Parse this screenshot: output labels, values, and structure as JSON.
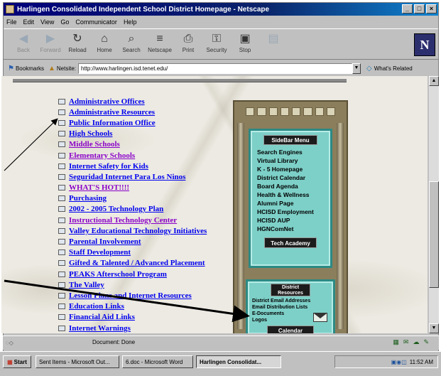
{
  "window": {
    "title": "Harlingen Consolidated Independent School District Homepage - Netscape",
    "controls": [
      "_",
      "□",
      "×"
    ]
  },
  "menu": [
    "File",
    "Edit",
    "View",
    "Go",
    "Communicator",
    "Help"
  ],
  "toolbar": {
    "buttons": [
      {
        "label": "Back",
        "icon": "back-arrow-icon",
        "glyph": "◀",
        "disabled": true
      },
      {
        "label": "Forward",
        "icon": "forward-arrow-icon",
        "glyph": "▶",
        "disabled": true
      },
      {
        "label": "Reload",
        "icon": "reload-icon",
        "glyph": "↻",
        "disabled": false
      },
      {
        "label": "Home",
        "icon": "home-icon",
        "glyph": "⌂",
        "disabled": false
      },
      {
        "label": "Search",
        "icon": "search-icon",
        "glyph": "⌕",
        "disabled": false
      },
      {
        "label": "Netscape",
        "icon": "netscape-icon",
        "glyph": "≡",
        "disabled": false
      },
      {
        "label": "Print",
        "icon": "print-icon",
        "glyph": "⎙",
        "disabled": false
      },
      {
        "label": "Security",
        "icon": "lock-icon",
        "glyph": "⚿",
        "disabled": false
      },
      {
        "label": "Stop",
        "icon": "stop-icon",
        "glyph": "▣",
        "disabled": false
      },
      {
        "label": "",
        "icon": "shop-icon",
        "glyph": "▤",
        "disabled": true
      }
    ],
    "logo": "N"
  },
  "location": {
    "bookmarks": "Bookmarks",
    "netsite": "Netsite:",
    "url": "http://www.harlingen.isd.tenet.edu/",
    "related": "What's Related"
  },
  "links": [
    {
      "text": "Administrative Offices",
      "visited": false
    },
    {
      "text": "Administrative Resources",
      "visited": false
    },
    {
      "text": "Public Information Office",
      "visited": false
    },
    {
      "text": "High Schools",
      "visited": false
    },
    {
      "text": "Middle Schools",
      "visited": true
    },
    {
      "text": "Elementary Schools",
      "visited": true
    },
    {
      "text": "Internet Safety for Kids",
      "visited": false
    },
    {
      "text": "Seguridad Internet Para Los Ninos",
      "visited": false
    },
    {
      "text": "WHAT'S HOT!!!!",
      "visited": true
    },
    {
      "text": "Purchasing",
      "visited": false
    },
    {
      "text": "2002 - 2005 Technology Plan",
      "visited": false
    },
    {
      "text": "Instructional Technology Center",
      "visited": true
    },
    {
      "text": "Valley Educational Technology Initiatives",
      "visited": false
    },
    {
      "text": "Parental Involvement",
      "visited": false
    },
    {
      "text": "Staff Development",
      "visited": false
    },
    {
      "text": "Gifted & Talented / Advanced Placement",
      "visited": false
    },
    {
      "text": "PEAKS Afterschool Program",
      "visited": false
    },
    {
      "text": "The Valley",
      "visited": false
    },
    {
      "text": "Lesson Plans and Internet Resources",
      "visited": false
    },
    {
      "text": "Education Links",
      "visited": false
    },
    {
      "text": "Financial Aid Links",
      "visited": false
    },
    {
      "text": "Internet Warnings",
      "visited": false
    }
  ],
  "sidebar": {
    "title": "SideBar Menu",
    "items": [
      "Search Engines",
      "Virtual Library",
      "K - 5 Homepage",
      "District Calendar",
      "Board Agenda",
      "Health & Wellness",
      "Alumni Page",
      "HCISD Employment",
      "HCISD AUP",
      "HGNComNet"
    ],
    "tech": "Tech Academy",
    "resources_title_1": "District",
    "resources_title_2": "Resources",
    "resources": [
      "District Email Addresses",
      "Email Distribution Lists",
      "E-Documents",
      "Logos"
    ],
    "calendar": "Calendar"
  },
  "status": {
    "text": "Document: Done"
  },
  "taskbar": {
    "start": "Start",
    "items": [
      {
        "label": "Sent Items - Microsoft Out...",
        "active": false
      },
      {
        "label": "6.doc - Microsoft Word",
        "active": false
      },
      {
        "label": "Harlingen Consolidat...",
        "active": true
      }
    ],
    "clock": "11:52 AM"
  },
  "colors": {
    "link": "#0000ee",
    "visited": "#8a00c8",
    "menu_teal": "#7dd0c8",
    "titlebar": "#00007b"
  }
}
